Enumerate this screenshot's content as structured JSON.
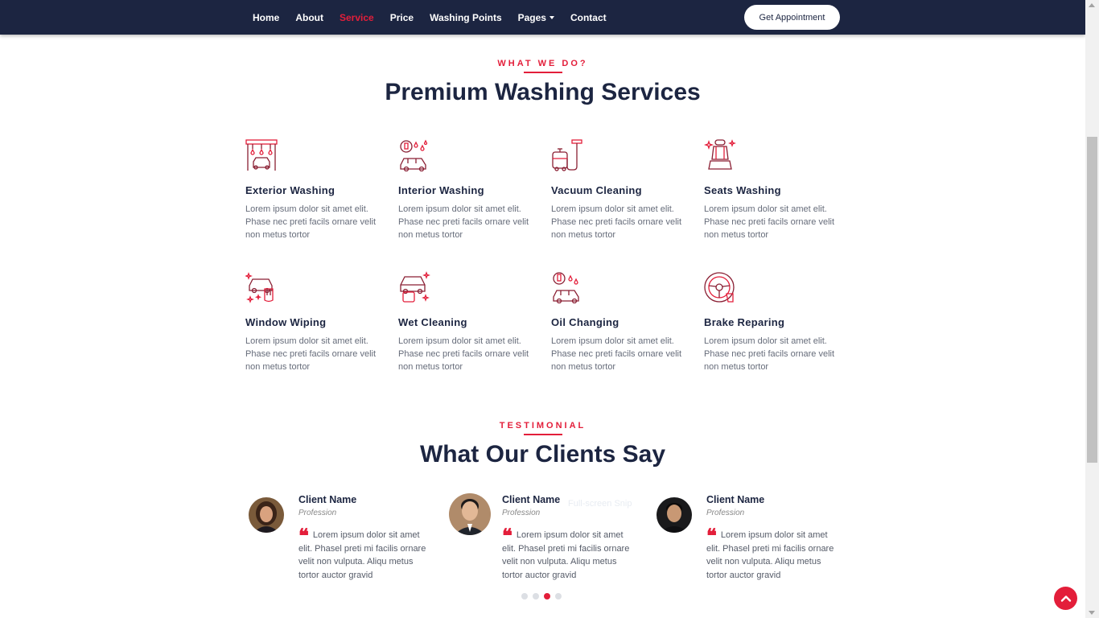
{
  "nav": {
    "items": [
      {
        "label": "Home"
      },
      {
        "label": "About"
      },
      {
        "label": "Service"
      },
      {
        "label": "Price"
      },
      {
        "label": "Washing Points"
      },
      {
        "label": "Pages"
      },
      {
        "label": "Contact"
      }
    ],
    "active_item": "Service",
    "cta_label": "Get Appointment"
  },
  "services_section": {
    "subtitle": "WHAT WE DO?",
    "title": "Premium Washing Services",
    "items": [
      {
        "title": "Exterior Washing",
        "icon": "car-wash-tunnel-icon",
        "description": "Lorem ipsum dolor sit amet elit. Phase nec preti facils ornare velit non metus tortor"
      },
      {
        "title": "Interior Washing",
        "icon": "car-interior-wash-icon",
        "description": "Lorem ipsum dolor sit amet elit. Phase nec preti facils ornare velit non metus tortor"
      },
      {
        "title": "Vacuum Cleaning",
        "icon": "vacuum-cleaner-icon",
        "description": "Lorem ipsum dolor sit amet elit. Phase nec preti facils ornare velit non metus tortor"
      },
      {
        "title": "Seats Washing",
        "icon": "car-seat-icon",
        "description": "Lorem ipsum dolor sit amet elit. Phase nec preti facils ornare velit non metus tortor"
      },
      {
        "title": "Window Wiping",
        "icon": "window-wiping-icon",
        "description": "Lorem ipsum dolor sit amet elit. Phase nec preti facils ornare velit non metus tortor"
      },
      {
        "title": "Wet Cleaning",
        "icon": "wet-cleaning-icon",
        "description": "Lorem ipsum dolor sit amet elit. Phase nec preti facils ornare velit non metus tortor"
      },
      {
        "title": "Oil Changing",
        "icon": "oil-change-icon",
        "description": "Lorem ipsum dolor sit amet elit. Phase nec preti facils ornare velit non metus tortor"
      },
      {
        "title": "Brake Reparing",
        "icon": "steering-wheel-icon",
        "description": "Lorem ipsum dolor sit amet elit. Phase nec preti facils ornare velit non metus tortor"
      }
    ]
  },
  "testimonial_section": {
    "subtitle": "TESTIMONIAL",
    "title": "What Our Clients Say",
    "items": [
      {
        "name": "Client Name",
        "profession": "Profession",
        "text": "Lorem ipsum dolor sit amet elit. Phasel preti mi facilis ornare velit non vulputa. Aliqu metus tortor auctor gravid"
      },
      {
        "name": "Client Name",
        "profession": "Profession",
        "text": "Lorem ipsum dolor sit amet elit. Phasel preti mi facilis ornare velit non vulputa. Aliqu metus tortor auctor gravid"
      },
      {
        "name": "Client Name",
        "profession": "Profession",
        "text": "Lorem ipsum dolor sit amet elit. Phasel preti mi facilis ornare velit non vulputa. Aliqu metus tortor auctor gravid"
      }
    ],
    "carousel_dots": 4,
    "active_dot": 3
  },
  "overlay_text": "Full-screen Snip",
  "colors": {
    "navbar_bg": "#1c2541",
    "accent": "#e31e3a",
    "heading": "#1c2541"
  },
  "icons": {
    "back_to_top": "chevron-up-icon",
    "quote": "quote-icon"
  }
}
